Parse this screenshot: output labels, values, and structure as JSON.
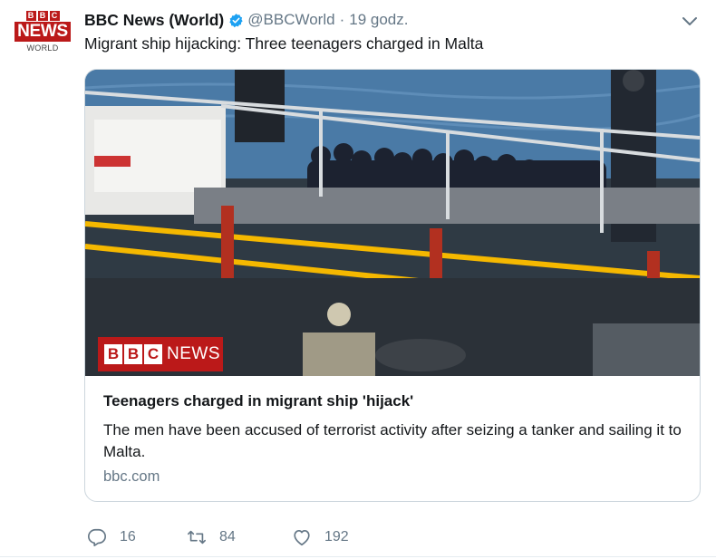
{
  "tweet": {
    "avatar": {
      "letters": [
        "B",
        "B",
        "C"
      ],
      "news": "NEWS",
      "world": "WORLD"
    },
    "display_name": "BBC News (World)",
    "handle": "@BBCWorld",
    "separator": "·",
    "time": "19 godz.",
    "text": "Migrant ship hijacking: Three teenagers charged in Malta",
    "card": {
      "image_watermark": {
        "letters": [
          "B",
          "B",
          "C"
        ],
        "word": "NEWS"
      },
      "title": "Teenagers charged in migrant ship 'hijack'",
      "description": "The men have been accused of terrorist activity after seizing a tanker and sailing it to Malta.",
      "domain": "bbc.com"
    },
    "actions": {
      "replies": "16",
      "retweets": "84",
      "likes": "192"
    }
  },
  "colors": {
    "bbc_red": "#bb1919",
    "verified_blue": "#1da1f2",
    "secondary_text": "#657786",
    "border": "#ccd6dd"
  },
  "icons": [
    "chevron-down-icon",
    "verified-badge-icon",
    "reply-icon",
    "retweet-icon",
    "like-icon"
  ]
}
